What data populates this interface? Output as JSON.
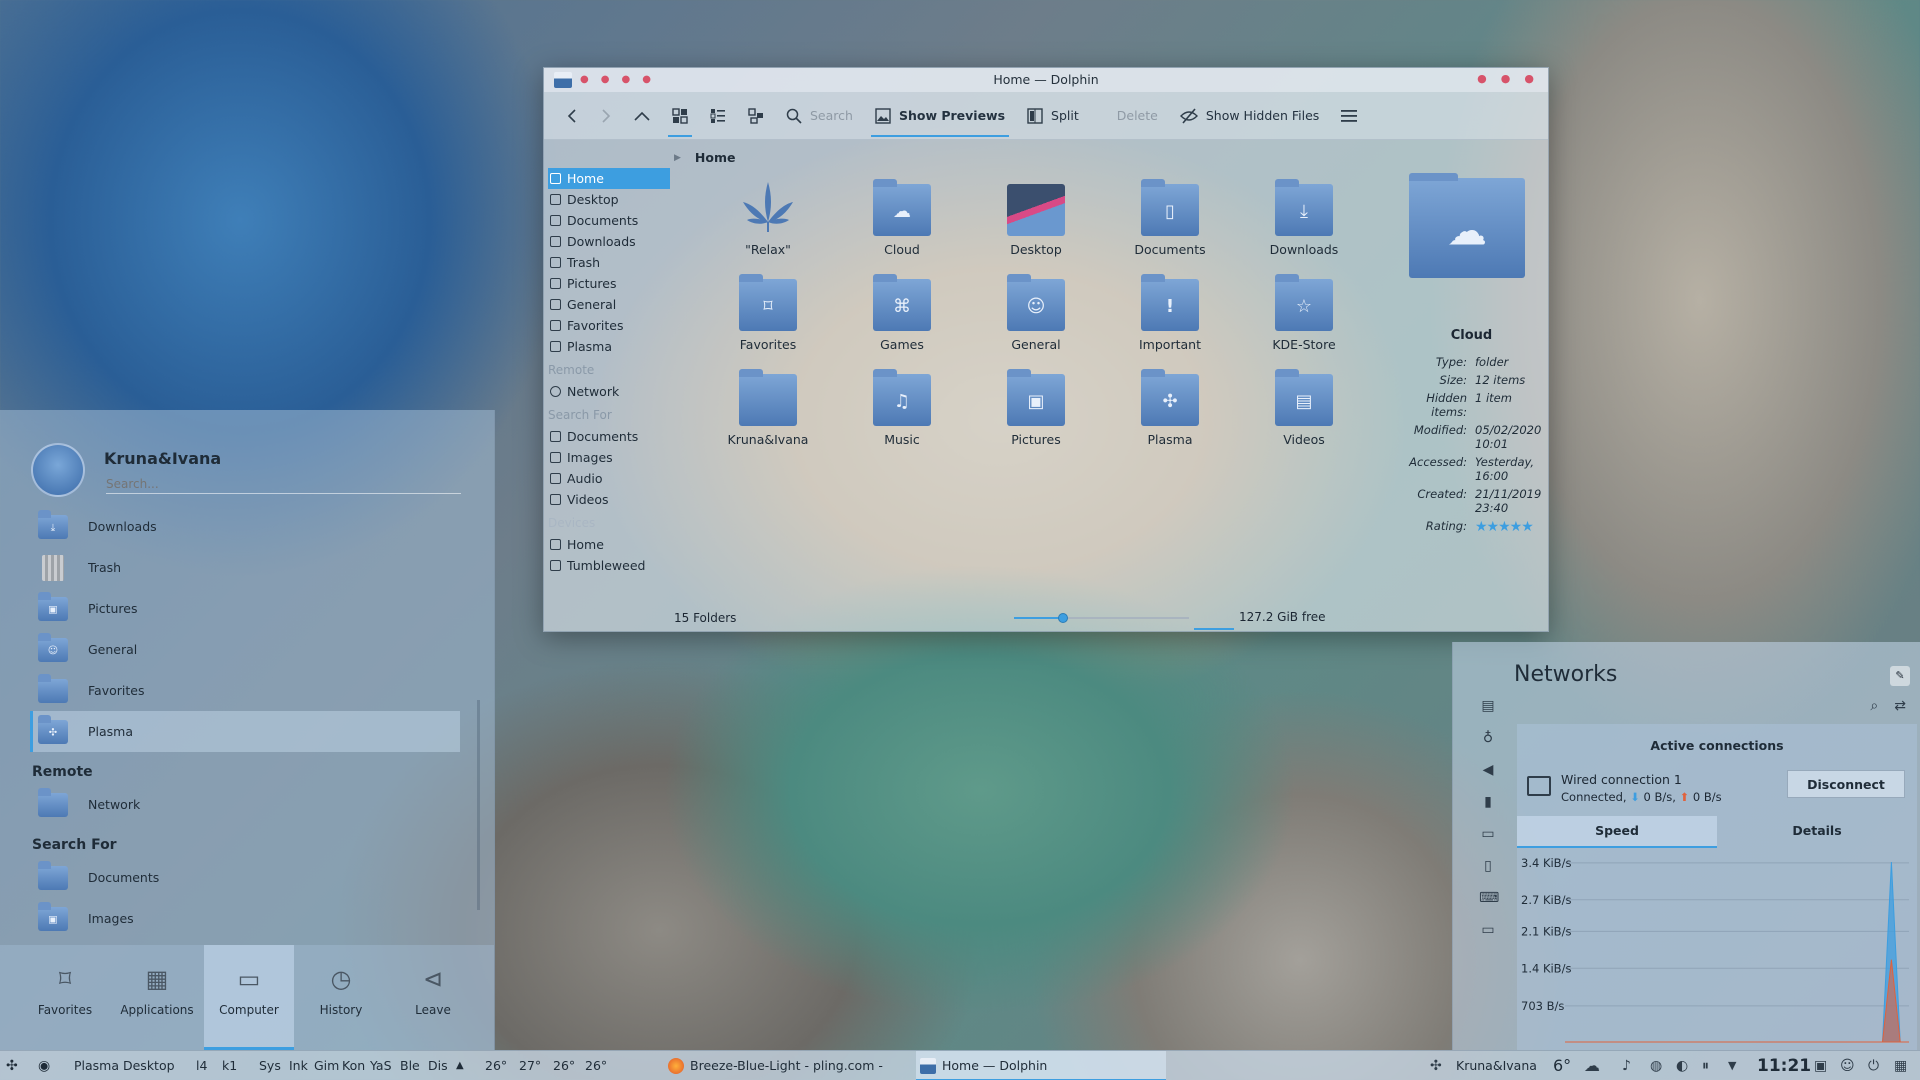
{
  "dolphin": {
    "title": "Home — Dolphin",
    "toolbar": {
      "search": "Search",
      "show_previews": "Show Previews",
      "split": "Split",
      "delete": "Delete",
      "show_hidden": "Show Hidden Files"
    },
    "places": {
      "items": [
        "Home",
        "Desktop",
        "Documents",
        "Downloads",
        "Trash",
        "Pictures",
        "General",
        "Favorites",
        "Plasma"
      ],
      "remote_header": "Remote",
      "remote_items": [
        "Network"
      ],
      "search_header": "Search For",
      "search_items": [
        "Documents",
        "Images",
        "Audio",
        "Videos"
      ],
      "devices_header": "Devices",
      "devices_items": [
        "Home",
        "Tumbleweed"
      ]
    },
    "breadcrumb": "Home",
    "folders": [
      "\"Relax\"",
      "Cloud",
      "Desktop",
      "Documents",
      "Downloads",
      "Favorites",
      "Games",
      "General",
      "Important",
      "KDE-Store",
      "Kruna&Ivana",
      "Music",
      "Pictures",
      "Plasma",
      "Videos"
    ],
    "info": {
      "name": "Cloud",
      "type_k": "Type:",
      "type_v": "folder",
      "size_k": "Size:",
      "size_v": "12 items",
      "hidden_k": "Hidden items:",
      "hidden_v": "1 item",
      "modified_k": "Modified:",
      "modified_v": "05/02/2020 10:01",
      "accessed_k": "Accessed:",
      "accessed_v": "Yesterday, 16:00",
      "created_k": "Created:",
      "created_v": "21/11/2019 23:40",
      "rating_k": "Rating:",
      "rating_stars": 5
    },
    "status": {
      "count": "15 Folders",
      "free": "127.2 GiB free",
      "zoom_fraction": 0.28
    }
  },
  "launcher": {
    "user": "Kruna&Ivana",
    "search_placeholder": "Search...",
    "items": [
      "Downloads",
      "Trash",
      "Pictures",
      "General",
      "Favorites",
      "Plasma"
    ],
    "remote_header": "Remote",
    "remote_items": [
      "Network"
    ],
    "search_header": "Search For",
    "search_items": [
      "Documents",
      "Images"
    ],
    "tabs": [
      "Favorites",
      "Applications",
      "Computer",
      "History",
      "Leave"
    ]
  },
  "networks": {
    "title": "Networks",
    "active_header": "Active connections",
    "connection_name": "Wired connection 1",
    "connection_status": "Connected,",
    "down": "0 B/s,",
    "up": "0 B/s",
    "disconnect": "Disconnect",
    "tab_speed": "Speed",
    "tab_details": "Details"
  },
  "chart_data": {
    "type": "area",
    "title": "",
    "xlabel": "",
    "ylabel": "",
    "y_tick_labels": [
      "3.4 KiB/s",
      "2.7 KiB/s",
      "2.1 KiB/s",
      "1.4 KiB/s",
      "703 B/s"
    ],
    "ylim_bytes_per_s": [
      0,
      3500
    ],
    "grid": true,
    "series": [
      {
        "color": "#3d9ee0",
        "values": [
          0,
          0,
          0,
          0,
          0,
          0,
          0,
          0,
          0,
          0,
          0,
          0,
          0,
          0,
          0,
          0,
          0,
          0,
          0,
          0,
          0,
          0,
          0,
          0,
          0,
          0,
          0,
          0,
          0,
          0,
          0,
          0,
          0,
          0,
          0,
          0,
          0,
          3600,
          0,
          0
        ]
      },
      {
        "color": "#e0623d",
        "values": [
          0,
          0,
          0,
          0,
          0,
          0,
          0,
          0,
          0,
          0,
          0,
          0,
          0,
          0,
          0,
          0,
          0,
          0,
          0,
          0,
          0,
          0,
          0,
          0,
          0,
          0,
          0,
          0,
          0,
          0,
          0,
          0,
          0,
          0,
          0,
          0,
          0,
          1600,
          0,
          0
        ]
      }
    ]
  },
  "taskbar": {
    "activity": "Plasma Desktop",
    "pager": [
      "l4",
      "k1"
    ],
    "tasks_short": [
      "Sys",
      "Ink",
      "Gim",
      "Kon",
      "YaS",
      "Ble",
      "Dis"
    ],
    "temps": [
      "26°",
      "27°",
      "26°",
      "26°"
    ],
    "firefox_task": "Breeze-Blue-Light - pling.com - Mo...",
    "dolphin_task": "Home — Dolphin",
    "user": "Kruna&Ivana",
    "weather": "6°",
    "clock": "11:21"
  },
  "colors": {
    "accent": "#3d9ee0",
    "upload": "#e0623d"
  }
}
